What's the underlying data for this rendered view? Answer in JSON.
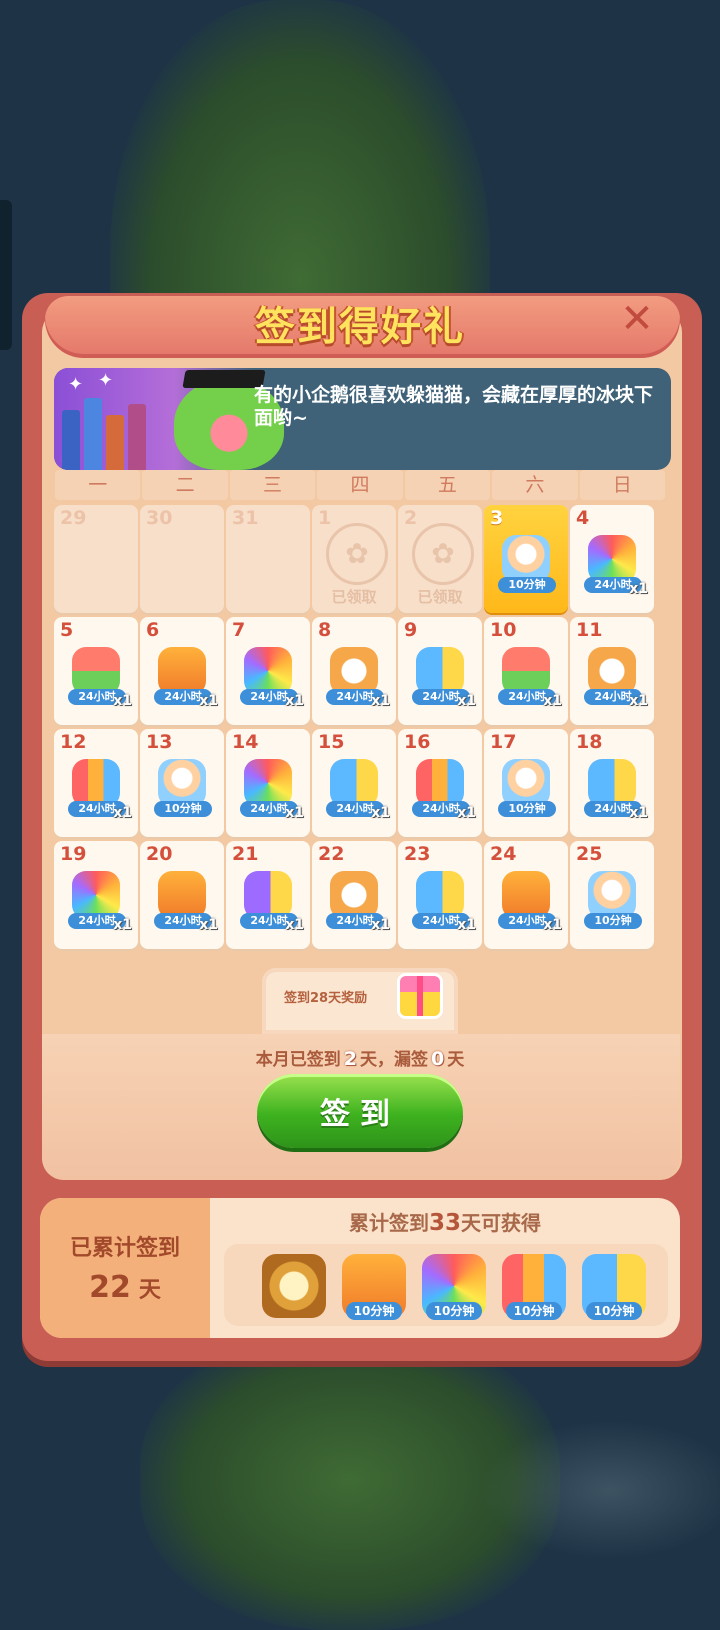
{
  "dialog": {
    "title": "签到得好礼",
    "close_icon": "close-icon",
    "banner_text": "有的小企鹅很喜欢躲猫猫，会藏在厚厚的冰块下面哟~"
  },
  "weekdays": [
    "一",
    "二",
    "三",
    "四",
    "五",
    "六",
    "日"
  ],
  "calendar": {
    "claimed_label": "已领取",
    "days": [
      {
        "day": "29",
        "state": "past"
      },
      {
        "day": "30",
        "state": "past"
      },
      {
        "day": "31",
        "state": "past"
      },
      {
        "day": "1",
        "state": "claimed"
      },
      {
        "day": "2",
        "state": "claimed"
      },
      {
        "day": "3",
        "state": "today",
        "reward": "bottle",
        "time": "10分钟"
      },
      {
        "day": "4",
        "state": "future",
        "reward": "rainbow-owl",
        "time": "24小时",
        "qty": "x1"
      },
      {
        "day": "5",
        "state": "future",
        "reward": "box",
        "time": "24小时",
        "qty": "x1"
      },
      {
        "day": "6",
        "state": "future",
        "reward": "plus3",
        "time": "24小时",
        "qty": "x1"
      },
      {
        "day": "7",
        "state": "future",
        "reward": "rainbow-owl",
        "time": "24小时",
        "qty": "x1"
      },
      {
        "day": "8",
        "state": "future",
        "reward": "clock",
        "time": "24小时",
        "qty": "x1"
      },
      {
        "day": "9",
        "state": "future",
        "reward": "bird-chick",
        "time": "24小时",
        "qty": "x1"
      },
      {
        "day": "10",
        "state": "future",
        "reward": "box",
        "time": "24小时",
        "qty": "x1"
      },
      {
        "day": "11",
        "state": "future",
        "reward": "clock",
        "time": "24小时",
        "qty": "x1"
      },
      {
        "day": "12",
        "state": "future",
        "reward": "rockets",
        "time": "24小时",
        "qty": "x1"
      },
      {
        "day": "13",
        "state": "future",
        "reward": "bottle",
        "time": "10分钟"
      },
      {
        "day": "14",
        "state": "future",
        "reward": "rainbow-owl",
        "time": "24小时",
        "qty": "x1"
      },
      {
        "day": "15",
        "state": "future",
        "reward": "bird-chick",
        "time": "24小时",
        "qty": "x1"
      },
      {
        "day": "16",
        "state": "future",
        "reward": "rockets",
        "time": "24小时",
        "qty": "x1"
      },
      {
        "day": "17",
        "state": "future",
        "reward": "bottle",
        "time": "10分钟"
      },
      {
        "day": "18",
        "state": "future",
        "reward": "bird-chick",
        "time": "24小时",
        "qty": "x1"
      },
      {
        "day": "19",
        "state": "future",
        "reward": "rainbow-owl",
        "time": "24小时",
        "qty": "x1"
      },
      {
        "day": "20",
        "state": "future",
        "reward": "plus3",
        "time": "24小时",
        "qty": "x1"
      },
      {
        "day": "21",
        "state": "future",
        "reward": "purple-owl",
        "time": "24小时",
        "qty": "x1"
      },
      {
        "day": "22",
        "state": "future",
        "reward": "clock",
        "time": "24小时",
        "qty": "x1"
      },
      {
        "day": "23",
        "state": "future",
        "reward": "bird-chick",
        "time": "24小时",
        "qty": "x1"
      },
      {
        "day": "24",
        "state": "future",
        "reward": "plus3",
        "time": "24小时",
        "qty": "x1"
      },
      {
        "day": "25",
        "state": "future",
        "reward": "bottle",
        "time": "10分钟"
      }
    ]
  },
  "bonus": {
    "label": "签到28天奖励",
    "icon": "gift-icon"
  },
  "summary": {
    "prefix": "本月已签到",
    "signed": "2",
    "middle": "天，漏签",
    "missed": "0",
    "suffix": "天"
  },
  "sign_button": "签到",
  "cumulative": {
    "label": "已累计签到",
    "days": "22",
    "unit": "天",
    "goal_prefix": "累计签到",
    "goal_days": "33",
    "goal_suffix": "天可获得",
    "rewards": [
      {
        "icon": "mystery-cat-badge-icon",
        "time": ""
      },
      {
        "icon": "plus3-icon",
        "time": "10分钟"
      },
      {
        "icon": "rainbow-owl-icon",
        "time": "10分钟"
      },
      {
        "icon": "rockets-icon",
        "time": "10分钟"
      },
      {
        "icon": "bird-chick-icon",
        "time": "10分钟"
      }
    ]
  },
  "colors": {
    "frame": "#c95e55",
    "panel": "#f3c9a4",
    "title": "#ffe25e",
    "button": "#3eb21f",
    "day_number": "#d4503c",
    "today": "#ffc22a"
  }
}
